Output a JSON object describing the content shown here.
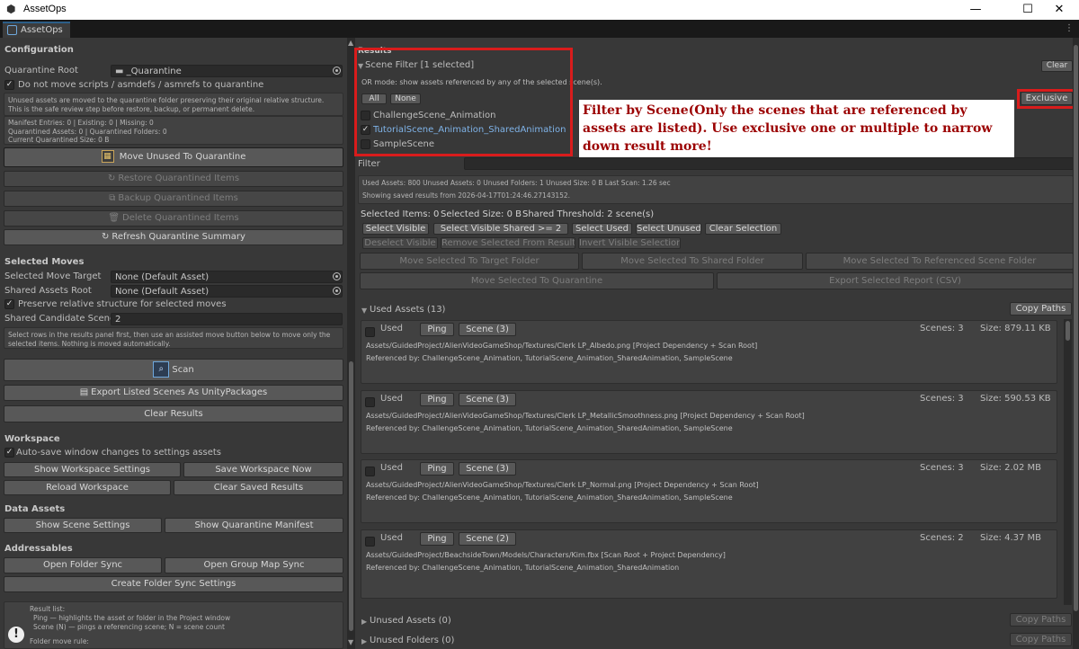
{
  "window": {
    "title": "AssetOps",
    "tab": "AssetOps"
  },
  "left": {
    "configuration": {
      "header": "Configuration",
      "quarantine_root_label": "Quarantine Root",
      "quarantine_root_value": "_Quarantine",
      "do_not_move_label": "Do not move scripts / asmdefs / asmrefs to quarantine",
      "help_text": "Unused assets are moved to the quarantine folder preserving their original relative structure. This is the safe review step before restore, backup, or permanent delete.",
      "manifest_line1": "Manifest Entries: 0  |  Existing: 0  |  Missing: 0",
      "manifest_line2": "Quarantined Assets: 0  |  Quarantined Folders: 0",
      "manifest_line3": "Current Quarantined Size: 0 B",
      "move_unused_button": "Move Unused To Quarantine",
      "restore_button": "Restore Quarantined Items",
      "backup_button": "Backup Quarantined Items",
      "delete_button": "Delete Quarantined Items",
      "refresh_button": "Refresh Quarantine Summary"
    },
    "selected_moves": {
      "header": "Selected Moves",
      "target_label": "Selected Move Target",
      "target_value": "None (Default Asset)",
      "shared_root_label": "Shared Assets Root",
      "shared_root_value": "None (Default Asset)",
      "preserve_label": "Preserve relative structure for selected moves",
      "candidate_label": "Shared Candidate Scene C",
      "candidate_value": "2",
      "help_text": "Select rows in the results panel first, then use an assisted move button below to move only the selected items. Nothing is moved automatically.",
      "scan_button": "Scan",
      "export_button": "Export Listed Scenes As UnityPackages",
      "clear_results_button": "Clear Results"
    },
    "workspace": {
      "header": "Workspace",
      "autosave_label": "Auto-save window changes to settings assets",
      "show_settings": "Show Workspace Settings",
      "save_now": "Save Workspace Now",
      "reload": "Reload Workspace",
      "clear_saved": "Clear Saved Results"
    },
    "data_assets": {
      "header": "Data Assets",
      "show_scene_settings": "Show Scene Settings",
      "show_manifest": "Show Quarantine Manifest"
    },
    "addressables": {
      "header": "Addressables",
      "open_folder_sync": "Open Folder Sync",
      "open_group_map": "Open Group Map Sync",
      "create_folder_sync": "Create Folder Sync Settings"
    },
    "legend": {
      "line1": "Result list:",
      "line2": "Ping — highlights the asset or folder in the Project window",
      "line3": "Scene (N) — pings a referencing scene; N = scene count",
      "line4": "Folder move rule:"
    }
  },
  "results": {
    "header": "Results",
    "clear_button": "Clear",
    "scene_filter": {
      "label": "Scene Filter  [1 selected]",
      "mode_text": "OR mode: show assets referenced by any of the selected scene(s).",
      "all_button": "All",
      "none_button": "None",
      "scenes": [
        {
          "name": "ChallengeScene_Animation",
          "checked": false
        },
        {
          "name": "TutorialScene_Animation_SharedAnimation",
          "checked": true
        },
        {
          "name": "SampleScene",
          "checked": false
        }
      ]
    },
    "exclusive_button": "Exclusive",
    "annotation": "Filter by Scene(Only the scenes that are referenced by assets are listed). Use exclusive one or multiple to narrow down result more!",
    "filter_label": "Filter",
    "filter_value": "",
    "stats_line": "Used Assets: 800    Unused Assets: 0    Unused Folders: 1    Unused Size: 0 B    Last Scan: 1.26 sec",
    "saved_line": "Showing saved results from 2026-04-17T01:24:46.27143152.",
    "selection": {
      "items": "Selected Items: 0",
      "size": "Selected Size: 0 B",
      "threshold": "Shared Threshold: 2 scene(s)"
    },
    "buttons": {
      "select_visible": "Select Visible",
      "select_shared": "Select Visible Shared >= 2",
      "select_used": "Select Used",
      "select_unused": "Select Unused",
      "clear_selection": "Clear Selection",
      "deselect_visible": "Deselect Visible",
      "remove_selected": "Remove Selected From Results",
      "invert_visible": "Invert Visible Selection",
      "move_target": "Move Selected To Target Folder",
      "move_shared": "Move Selected To Shared Folder",
      "move_referenced": "Move Selected To Referenced Scene Folder",
      "move_quarantine": "Move Selected To Quarantine",
      "export_report": "Export Selected Report (CSV)"
    },
    "used_assets": {
      "header": "Used Assets (13)",
      "copy_paths": "Copy Paths",
      "rows": [
        {
          "used": "Used",
          "ping": "Ping",
          "scene_btn": "Scene (3)",
          "scenes": "Scenes: 3",
          "size": "Size: 879.11 KB",
          "path": "Assets/GuidedProject/AlienVideoGameShop/Textures/Clerk LP_Albedo.png    [Project Dependency + Scan Root]",
          "ref": "Referenced by: ChallengeScene_Animation, TutorialScene_Animation_SharedAnimation, SampleScene"
        },
        {
          "used": "Used",
          "ping": "Ping",
          "scene_btn": "Scene (3)",
          "scenes": "Scenes: 3",
          "size": "Size: 590.53 KB",
          "path": "Assets/GuidedProject/AlienVideoGameShop/Textures/Clerk LP_MetallicSmoothness.png    [Project Dependency + Scan Root]",
          "ref": "Referenced by: ChallengeScene_Animation, TutorialScene_Animation_SharedAnimation, SampleScene"
        },
        {
          "used": "Used",
          "ping": "Ping",
          "scene_btn": "Scene (3)",
          "scenes": "Scenes: 3",
          "size": "Size: 2.02 MB",
          "path": "Assets/GuidedProject/AlienVideoGameShop/Textures/Clerk LP_Normal.png    [Project Dependency + Scan Root]",
          "ref": "Referenced by: ChallengeScene_Animation, TutorialScene_Animation_SharedAnimation, SampleScene"
        },
        {
          "used": "Used",
          "ping": "Ping",
          "scene_btn": "Scene (2)",
          "scenes": "Scenes: 2",
          "size": "Size: 4.37 MB",
          "path": "Assets/GuidedProject/BeachsideTown/Models/Characters/Kim.fbx    [Scan Root + Project Dependency]",
          "ref": "Referenced by: ChallengeScene_Animation, TutorialScene_Animation_SharedAnimation"
        }
      ]
    },
    "unused_assets": {
      "header": "Unused Assets (0)",
      "copy_paths": "Copy Paths"
    },
    "unused_folders": {
      "header": "Unused Folders (0)",
      "copy_paths": "Copy Paths"
    }
  }
}
